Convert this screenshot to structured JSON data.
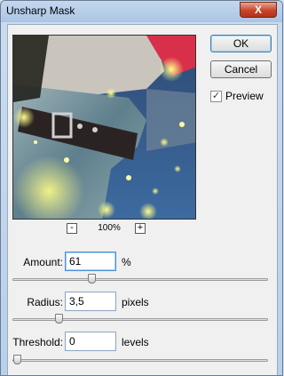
{
  "window": {
    "title": "Unsharp Mask",
    "close_label": "X"
  },
  "buttons": {
    "ok_label": "OK",
    "cancel_label": "Cancel"
  },
  "preview_option": {
    "label": "Preview",
    "checked": true,
    "check_glyph": "✓"
  },
  "zoom": {
    "value": "100%",
    "minus_label": "-",
    "plus_label": "+"
  },
  "amount": {
    "label": "Amount:",
    "value": "61",
    "unit": "%",
    "slider_fraction": 0.3
  },
  "radius": {
    "label": "Radius:",
    "value": "3,5",
    "unit": "pixels",
    "slider_fraction": 0.17
  },
  "threshold": {
    "label": "Threshold:",
    "value": "0",
    "unit": "levels",
    "slider_fraction": 0.0
  },
  "icons": {
    "preview_image": "photo-jeans-belt-preview-icon"
  }
}
